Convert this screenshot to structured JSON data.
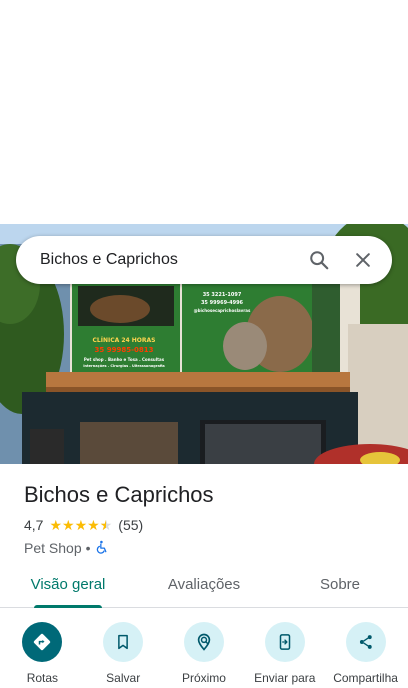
{
  "search": {
    "query": "Bichos e Caprichos"
  },
  "place": {
    "name": "Bichos e Caprichos",
    "rating": "4,7",
    "rating_value": 4.7,
    "review_count": "(55)",
    "category": "Pet Shop",
    "separator": "•"
  },
  "storefront_sign": {
    "left_text": [
      "CLÍNICA 24 HORAS",
      "35 99985-0813",
      "Pet shop . Banho e Tosa . Consultas",
      "Internações . Cirurgias . Ultrassonografia"
    ],
    "right_text": [
      "35 3221-1097",
      "35 99969-4996",
      "@bichosecaprichoslavras"
    ]
  },
  "tabs": [
    {
      "label": "Visão geral",
      "active": true
    },
    {
      "label": "Avaliações",
      "active": false
    },
    {
      "label": "Sobre",
      "active": false
    }
  ],
  "actions": [
    {
      "label": "Rotas",
      "icon": "directions-icon"
    },
    {
      "label": "Salvar",
      "icon": "bookmark-icon"
    },
    {
      "label": "Próximo",
      "icon": "nearby-icon"
    },
    {
      "label": "Enviar para",
      "icon": "send-to-phone-icon"
    },
    {
      "label": "Compartilha",
      "icon": "share-icon"
    }
  ],
  "colors": {
    "accent": "#00796b",
    "primary_action": "#006978",
    "action_bg": "#d6f1f6",
    "star": "#fbbc04"
  }
}
